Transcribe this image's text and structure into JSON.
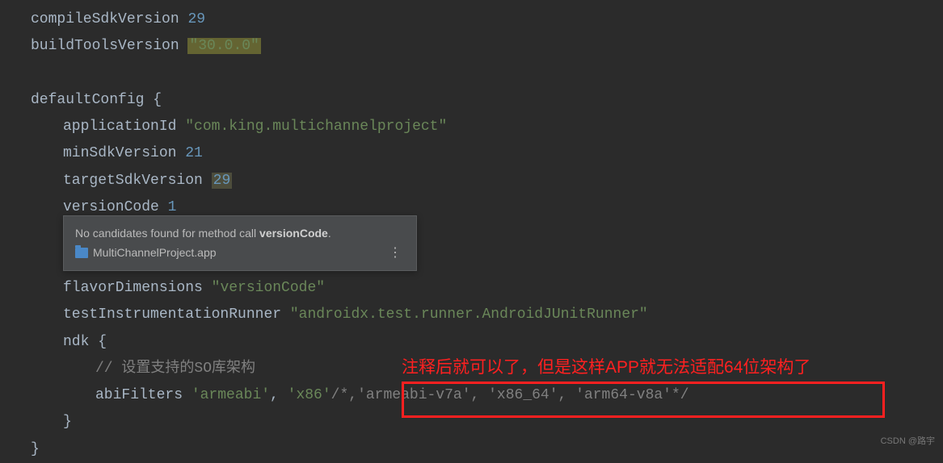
{
  "code": {
    "compileSdk": "compileSdkVersion ",
    "compileSdkVal": "29",
    "buildTools": "buildToolsVersion ",
    "buildToolsVal": "\"30.0.0\"",
    "defaultConfig": "defaultConfig ",
    "openBrace": "{",
    "closeBrace": "}",
    "appId": "applicationId ",
    "appIdVal": "\"com.king.multichannelproject\"",
    "minSdk": "minSdkVersion ",
    "minSdkVal": "21",
    "targetSdk": "targetSdkVersion ",
    "targetSdkVal": "29",
    "versionCode": "versionCode ",
    "versionCodeVal": "1",
    "flavorDim": "flavorDimensions ",
    "flavorDimVal": "\"versionCode\"",
    "testRunner": "testInstrumentationRunner ",
    "testRunnerVal": "\"androidx.test.runner.AndroidJUnitRunner\"",
    "ndk": "ndk ",
    "soComment": "// 设置支持的SO库架构",
    "abiFilters": "abiFilters ",
    "abi1": "'armeabi'",
    "abiComma": ", ",
    "abi2": "'x86'",
    "abiCommentStart": "/*,",
    "abi3": "'armeabi-v7a'",
    "abi4": "'x86_64'",
    "abi5": "'arm64-v8a'",
    "abiCommentEnd": "*/"
  },
  "tooltip": {
    "prefix": "No candidates found for method call ",
    "method": "versionCode",
    "suffix": ".",
    "project": "MultiChannelProject.app"
  },
  "annotation": {
    "redText": "注释后就可以了，但是这样APP就无法适配64位架构了"
  },
  "watermark": "CSDN @路宇"
}
